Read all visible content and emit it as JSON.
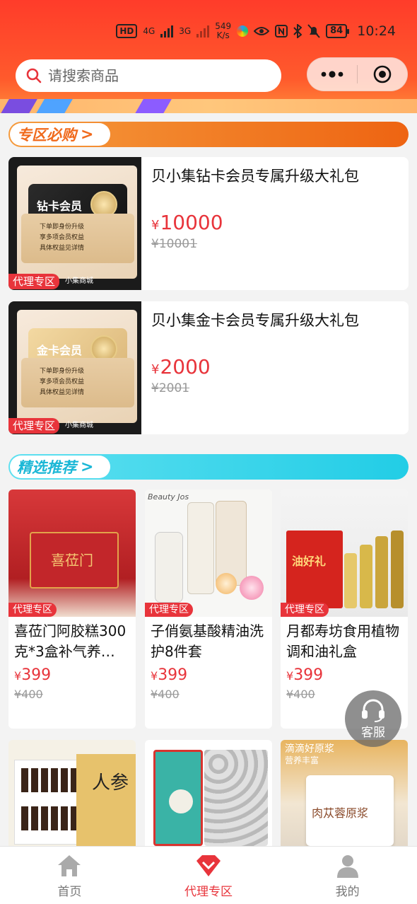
{
  "status_bar": {
    "net1": "HD",
    "net2": "4G",
    "net3": "3G",
    "speed_value": "549",
    "speed_unit": "K/s",
    "battery": "84",
    "time": "10:24"
  },
  "search": {
    "placeholder": "请搜索商品"
  },
  "sections": {
    "zone_title": "专区必购",
    "featured_title": "精选推荐"
  },
  "zone_items": [
    {
      "name": "贝小集钻卡会员专属升级大礼包",
      "price_symbol": "¥",
      "price": "10000",
      "old_price": "¥10001",
      "card_title": "钻卡会员",
      "badge": "代理专区",
      "brand": "小集商城",
      "lines": [
        "下单即身份升级",
        "享多项会员权益",
        "具体权益见详情"
      ]
    },
    {
      "name": "贝小集金卡会员专属升级大礼包",
      "price_symbol": "¥",
      "price": "2000",
      "old_price": "¥2001",
      "card_title": "金卡会员",
      "badge": "代理专区",
      "brand": "小集商城",
      "lines": [
        "下单即身份升级",
        "享多项会员权益",
        "具体权益见详情"
      ]
    }
  ],
  "products": [
    {
      "name": "喜莅门阿胶糕300克*3盒补气养…",
      "price_symbol": "¥",
      "price": "399",
      "old_price": "¥400",
      "badge": "代理专区",
      "pack_text": "喜莅门"
    },
    {
      "name": "子俏氨基酸精油洗护8件套",
      "price_symbol": "¥",
      "price": "399",
      "old_price": "¥400",
      "badge": "代理专区",
      "brand_text": "Beauty Jos"
    },
    {
      "name": "月都寿坊食用植物调和油礼盒",
      "price_symbol": "¥",
      "price": "399",
      "old_price": "¥400",
      "badge": "代理专区",
      "pack_text": "油好礼"
    }
  ],
  "products_row2": [
    {
      "pack_text": "人参"
    },
    {
      "pack_text": ""
    },
    {
      "top_text": "滴滴好原浆",
      "sub_text": "营养丰富",
      "pack_text": "肉苁蓉原浆"
    }
  ],
  "service": {
    "label": "客服"
  },
  "tabbar": [
    {
      "label": "首页",
      "icon": "home-icon",
      "active": false
    },
    {
      "label": "代理专区",
      "icon": "diamond-icon",
      "active": true
    },
    {
      "label": "我的",
      "icon": "user-icon",
      "active": false
    }
  ],
  "colors": {
    "header_red": "#ff3c2a",
    "accent": "#e8343b",
    "zone_bar": "#f06a1c",
    "featured_bar": "#2fd0e6"
  }
}
